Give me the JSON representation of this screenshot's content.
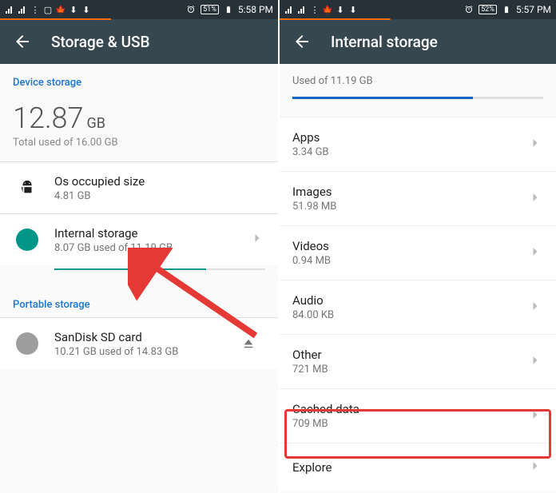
{
  "left": {
    "statusbar": {
      "battery": "51%",
      "time": "5:58 PM"
    },
    "appbar_title": "Storage & USB",
    "device_storage_header": "Device storage",
    "big_value": "12.87",
    "big_unit": "GB",
    "big_sub": "Total used of 16.00 GB",
    "os_item": {
      "title": "Os occupied size",
      "sub": "4.81 GB"
    },
    "internal_item": {
      "title": "Internal storage",
      "sub": "8.07 GB used of 11.19 GB"
    },
    "portable_header": "Portable storage",
    "sd_item": {
      "title": "SanDisk SD card",
      "sub": "10.21 GB used of 14.83 GB"
    }
  },
  "right": {
    "statusbar": {
      "battery": "52%",
      "time": "5:57 PM"
    },
    "appbar_title": "Internal storage",
    "used_sub": "Used of 11.19 GB",
    "items": [
      {
        "title": "Apps",
        "sub": "3.34 GB"
      },
      {
        "title": "Images",
        "sub": "51.98 MB"
      },
      {
        "title": "Videos",
        "sub": "0.94 MB"
      },
      {
        "title": "Audio",
        "sub": "84.00 KB"
      },
      {
        "title": "Other",
        "sub": "721 MB"
      },
      {
        "title": "Cached data",
        "sub": "709 MB"
      },
      {
        "title": "Explore",
        "sub": ""
      }
    ]
  }
}
